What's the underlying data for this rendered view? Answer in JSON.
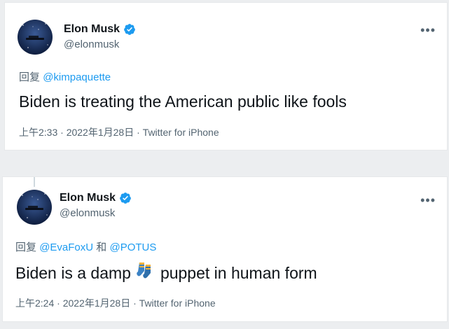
{
  "colors": {
    "link": "#1d9bf0",
    "verified": "#1d9bf0",
    "muted": "#536471",
    "text": "#0f1419"
  },
  "tweets": [
    {
      "author_name": "Elon Musk",
      "author_handle": "@elonmusk",
      "reply_label": "回复",
      "mentions": [
        "@kimpaquette"
      ],
      "text": "Biden is treating the American public like fools",
      "time": "上午2:33",
      "date": "2022年1月28日",
      "source": "Twitter for iPhone",
      "separator": " · "
    },
    {
      "author_name": "Elon Musk",
      "author_handle": "@elonmusk",
      "reply_label": "回复",
      "mentions": [
        "@EvaFoxU",
        "@POTUS"
      ],
      "mention_joiner": "和",
      "text_before": "Biden is a damp",
      "emoji_icon": "socks-icon",
      "text_after": "puppet in human form",
      "time": "上午2:24",
      "date": "2022年1月28日",
      "source": "Twitter for iPhone",
      "separator": " · "
    }
  ]
}
